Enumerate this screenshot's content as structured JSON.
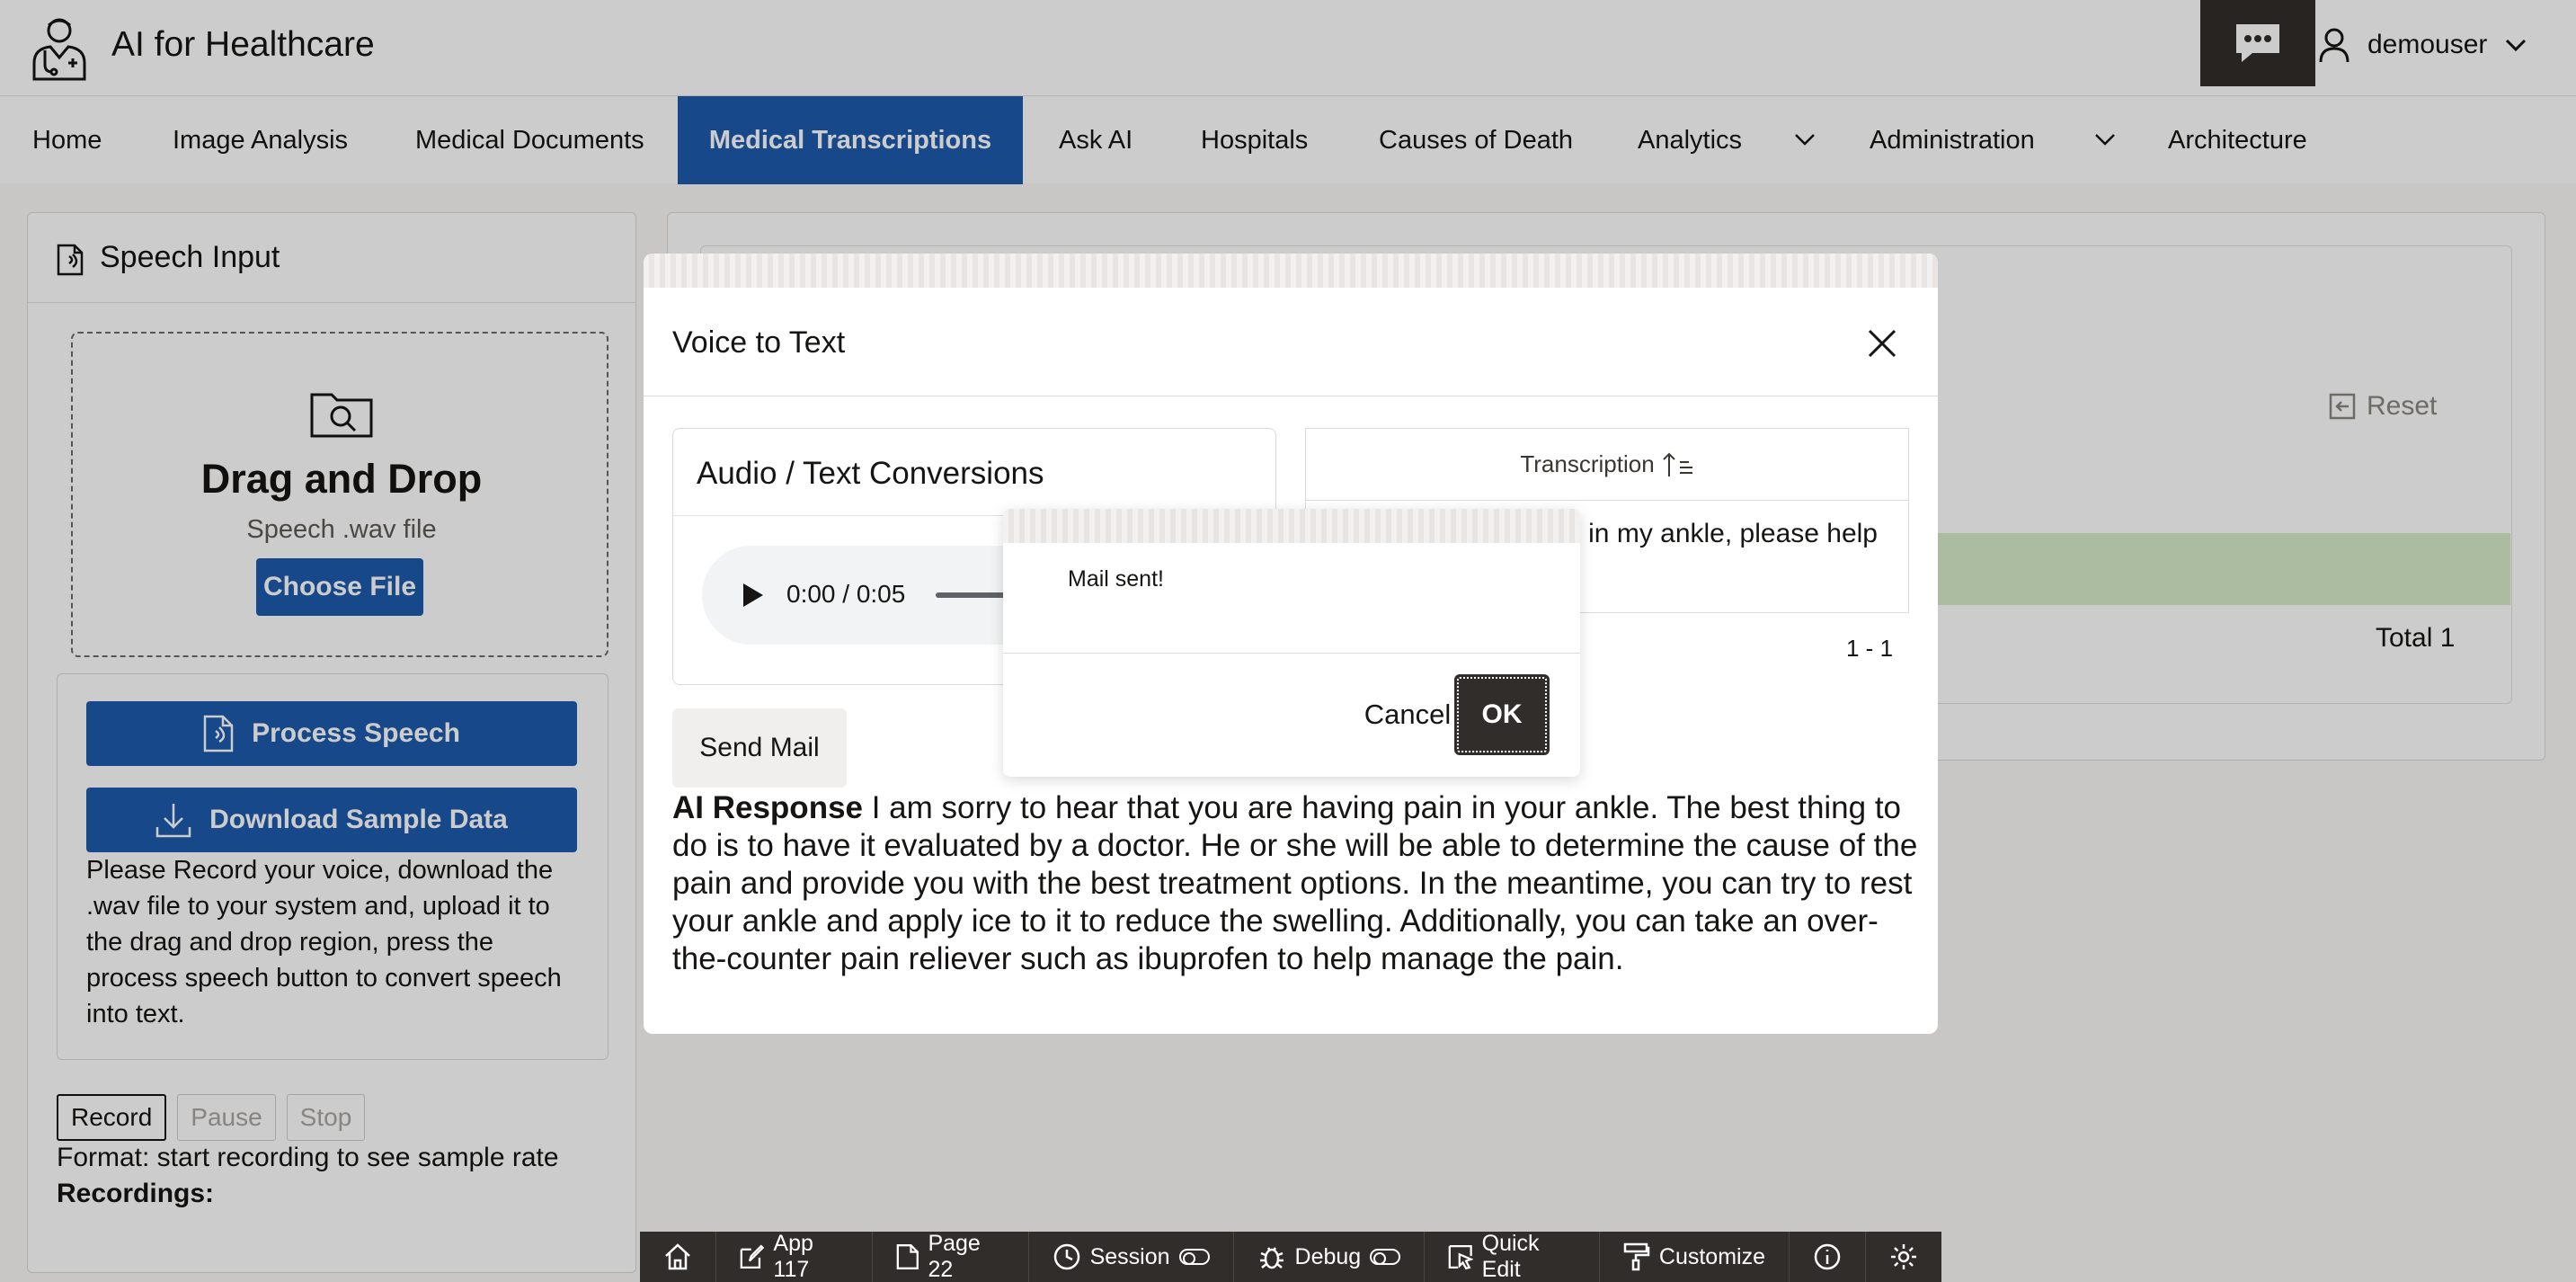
{
  "header": {
    "app_title": "AI for Healthcare",
    "username": "demouser"
  },
  "nav": {
    "items": [
      {
        "label": "Home"
      },
      {
        "label": "Image Analysis"
      },
      {
        "label": "Medical Documents"
      },
      {
        "label": "Medical Transcriptions",
        "active": true
      },
      {
        "label": "Ask AI"
      },
      {
        "label": "Hospitals"
      },
      {
        "label": "Causes of Death"
      },
      {
        "label": "Analytics"
      },
      {
        "label": "Administration"
      },
      {
        "label": "Architecture"
      }
    ]
  },
  "speech_panel": {
    "title": "Speech Input",
    "drop_title": "Drag and Drop",
    "drop_subtitle": "Speech .wav file",
    "choose_file": "Choose File",
    "process_speech": "Process Speech",
    "download_sample": "Download Sample Data",
    "instructions": "Please Record your voice, download the .wav file to your system and, upload it to the drag and drop region, press the process speech button to convert speech into text.",
    "record": "Record",
    "pause": "Pause",
    "stop": "Stop",
    "format_text": "Format: start recording to see sample rate",
    "recordings_label": "Recordings:"
  },
  "background_report": {
    "reset": "Reset",
    "total": "Total 1"
  },
  "modal": {
    "title": "Voice to Text",
    "conversions_title": "Audio / Text Conversions",
    "audio_time": "0:00 / 0:05",
    "transcription_header": "Transcription",
    "transcription_text": "in in my ankle, please help",
    "pagination": "1 - 1",
    "send_mail": "Send Mail",
    "ai_response_label": "AI Response",
    "ai_response_text": "I am sorry to hear that you are having pain in your ankle. The best thing to do is to have it evaluated by a doctor. He or she will be able to determine the cause of the pain and provide you with the best treatment options. In the meantime, you can try to rest your ankle and apply ice to it to reduce the swelling. Additionally, you can take an over-the-counter pain reliever such as ibuprofen to help manage the pain."
  },
  "alert": {
    "message": "Mail sent!",
    "cancel": "Cancel",
    "ok": "OK"
  },
  "dev_toolbar": {
    "app": "App 117",
    "page": "Page 22",
    "session": "Session",
    "debug": "Debug",
    "quick_edit": "Quick Edit",
    "customize": "Customize"
  },
  "colors": {
    "primary": "#1d5cad",
    "dark": "#312d2a",
    "highlight_row": "#d8ecc8"
  }
}
